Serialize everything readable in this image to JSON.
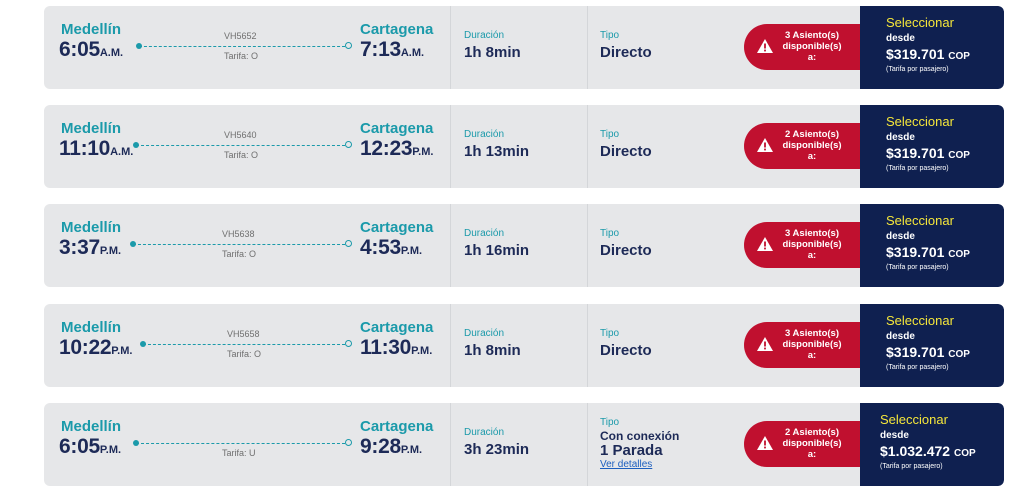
{
  "labels": {
    "duration": "Duración",
    "type": "Tipo",
    "select": "Seleccionar",
    "from": "desde",
    "per_passenger": "(Tarifa por pasajero)",
    "currency": "COP",
    "details_link": "Ver detalles"
  },
  "flights": [
    {
      "origin": "Medellín",
      "dep_time": "6:05",
      "dep_ampm": "A.M.",
      "destination": "Cartagena",
      "arr_time": "7:13",
      "arr_ampm": "A.M.",
      "flight_no": "VH5652",
      "fare": "Tarifa: O",
      "duration": "1h 8min",
      "type": "Directo",
      "stops": "",
      "seats_line1": "3 Asiento(s)",
      "seats_line2": "disponible(s)",
      "seats_line3": "a:",
      "price": "$319.701"
    },
    {
      "origin": "Medellín",
      "dep_time": "11:10",
      "dep_ampm": "A.M.",
      "destination": "Cartagena",
      "arr_time": "12:23",
      "arr_ampm": "P.M.",
      "flight_no": "VH5640",
      "fare": "Tarifa: O",
      "duration": "1h 13min",
      "type": "Directo",
      "stops": "",
      "seats_line1": "2 Asiento(s)",
      "seats_line2": "disponible(s)",
      "seats_line3": "a:",
      "price": "$319.701"
    },
    {
      "origin": "Medellín",
      "dep_time": "3:37",
      "dep_ampm": "P.M.",
      "destination": "Cartagena",
      "arr_time": "4:53",
      "arr_ampm": "P.M.",
      "flight_no": "VH5638",
      "fare": "Tarifa: O",
      "duration": "1h 16min",
      "type": "Directo",
      "stops": "",
      "seats_line1": "3 Asiento(s)",
      "seats_line2": "disponible(s)",
      "seats_line3": "a:",
      "price": "$319.701"
    },
    {
      "origin": "Medellín",
      "dep_time": "10:22",
      "dep_ampm": "P.M.",
      "destination": "Cartagena",
      "arr_time": "11:30",
      "arr_ampm": "P.M.",
      "flight_no": "VH5658",
      "fare": "Tarifa: O",
      "duration": "1h 8min",
      "type": "Directo",
      "stops": "",
      "seats_line1": "3 Asiento(s)",
      "seats_line2": "disponible(s)",
      "seats_line3": "a:",
      "price": "$319.701"
    },
    {
      "origin": "Medellín",
      "dep_time": "6:05",
      "dep_ampm": "P.M.",
      "destination": "Cartagena",
      "arr_time": "9:28",
      "arr_ampm": "P.M.",
      "flight_no": "",
      "fare": "Tarifa: U",
      "duration": "3h 23min",
      "type": "Con conexión",
      "stops": "1 Parada",
      "seats_line1": "2 Asiento(s)",
      "seats_line2": "disponible(s)",
      "seats_line3": "a:",
      "price": "$1.032.472"
    }
  ],
  "colors": {
    "card_bg": "#e6e7e9",
    "accent_teal": "#1b9aaa",
    "text_navy": "#1d2a57",
    "alert_red": "#c0102f",
    "select_bg": "#0f2050",
    "select_label": "#f5e63a"
  },
  "icons": {
    "seat_alert": "warning-triangle-icon"
  }
}
